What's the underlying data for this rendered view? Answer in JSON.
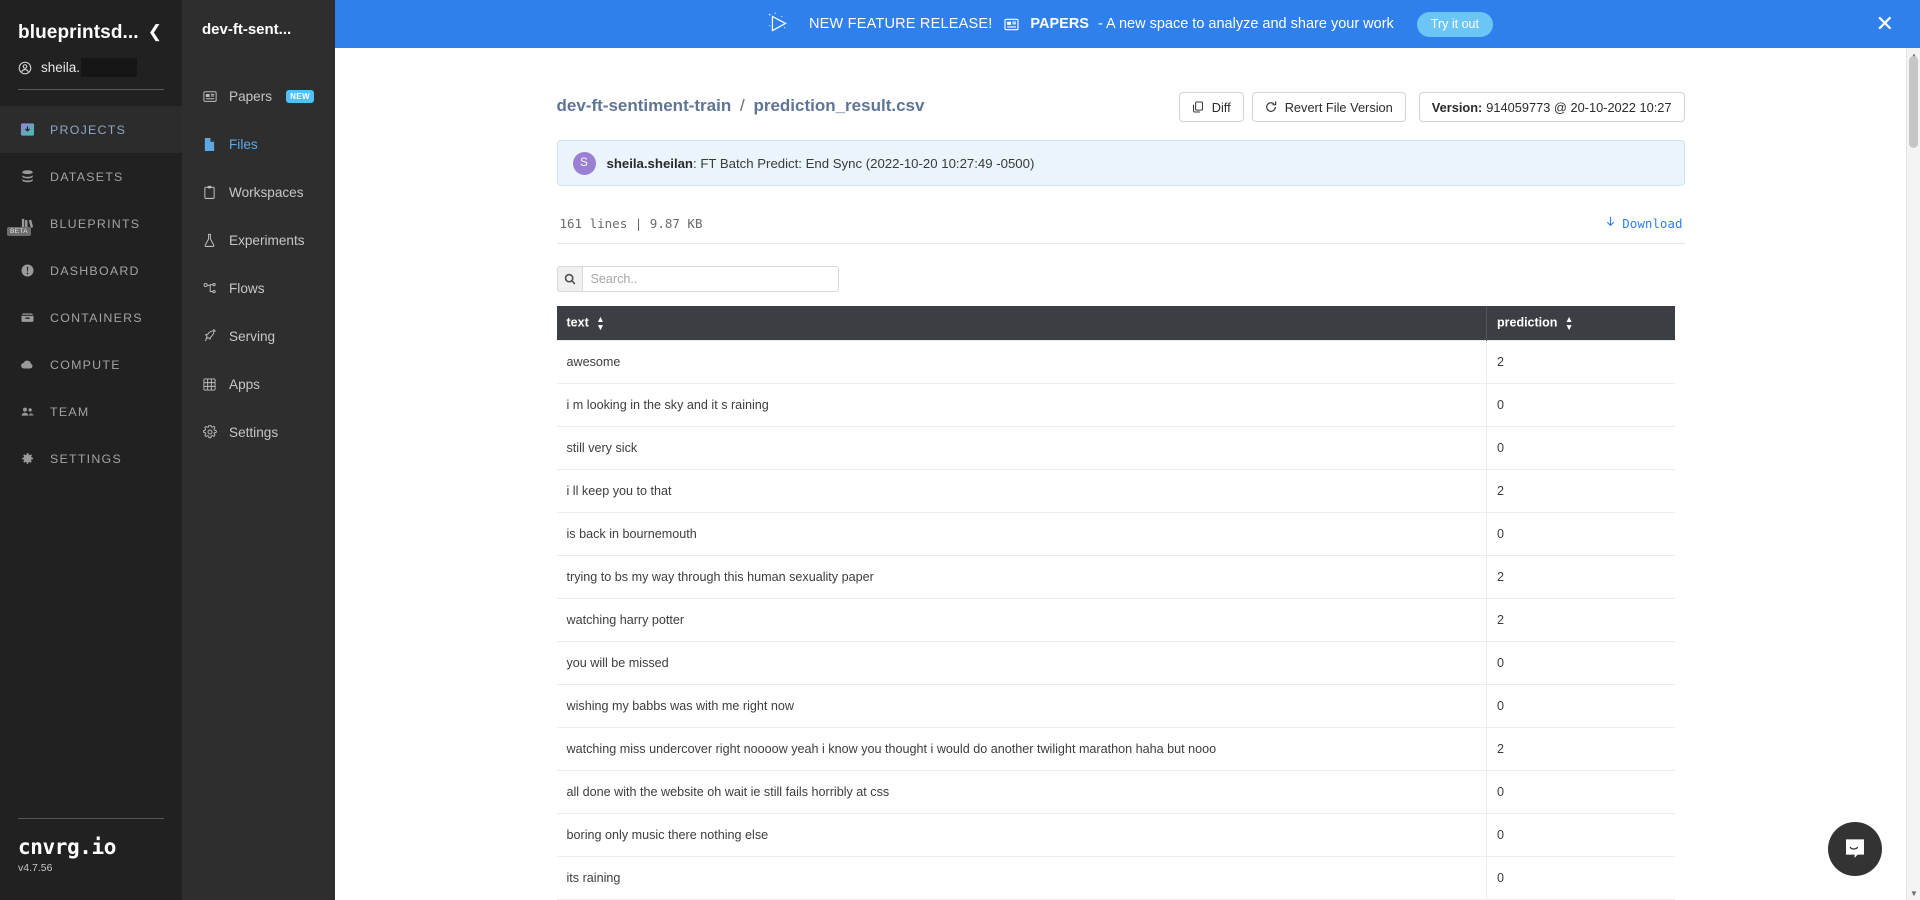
{
  "primary_sidebar": {
    "org_name": "blueprintsd...",
    "collapse_icon": "chevron-left-icon",
    "user_name": "sheila.",
    "items": [
      {
        "label": "PROJECTS",
        "icon": "projects-icon",
        "active": true
      },
      {
        "label": "DATASETS",
        "icon": "database-icon",
        "active": false
      },
      {
        "label": "BLUEPRINTS",
        "icon": "blueprints-icon",
        "active": false,
        "badge": "BETA"
      },
      {
        "label": "DASHBOARD",
        "icon": "gauge-icon",
        "active": false
      },
      {
        "label": "CONTAINERS",
        "icon": "container-icon",
        "active": false
      },
      {
        "label": "COMPUTE",
        "icon": "cloud-icon",
        "active": false
      },
      {
        "label": "TEAM",
        "icon": "team-icon",
        "active": false
      },
      {
        "label": "SETTINGS",
        "icon": "gear-icon",
        "active": false
      }
    ],
    "brand": "cnvrg.io",
    "version": "v4.7.56"
  },
  "secondary_sidebar": {
    "project_title": "dev-ft-sent...",
    "items": [
      {
        "label": "Papers",
        "icon": "papers-icon",
        "badge": "NEW",
        "active": false
      },
      {
        "label": "Files",
        "icon": "file-icon",
        "active": true
      },
      {
        "label": "Workspaces",
        "icon": "clipboard-icon",
        "active": false
      },
      {
        "label": "Experiments",
        "icon": "flask-icon",
        "active": false
      },
      {
        "label": "Flows",
        "icon": "flow-icon",
        "active": false
      },
      {
        "label": "Serving",
        "icon": "rocket-icon",
        "active": false
      },
      {
        "label": "Apps",
        "icon": "grid-icon",
        "active": false
      },
      {
        "label": "Settings",
        "icon": "gear-icon",
        "active": false
      }
    ]
  },
  "banner": {
    "kite_icon": "kite-icon",
    "lead": "NEW FEATURE RELEASE!",
    "doc_icon": "papers-icon",
    "product": "PAPERS",
    "rest": "- A new space to analyze and share your work",
    "cta_label": "Try it out",
    "close_icon": "close-icon",
    "background": "#2f80ed",
    "cta_background": "#6cc6f5"
  },
  "page": {
    "breadcrumb": {
      "project": "dev-ft-sentiment-train",
      "separator": "/",
      "file": "prediction_result.csv"
    },
    "actions": {
      "diff_label": "Diff",
      "diff_icon": "copy-icon",
      "revert_label": "Revert File Version",
      "revert_icon": "refresh-icon",
      "version_prefix": "Version:",
      "version_value": "914059773 @ 20-10-2022 10:27"
    },
    "commit": {
      "avatar_initial": "S",
      "author": "sheila.sheilan",
      "message": ": FT Batch Predict: End Sync (2022-10-20 10:27:49 -0500)"
    },
    "file_stats": "161 lines | 9.87 KB",
    "download_label": "Download",
    "download_icon": "download-arrow-icon",
    "search": {
      "placeholder": "Search..",
      "value": "",
      "icon": "search-icon"
    }
  },
  "table": {
    "columns": [
      {
        "label": "text",
        "sort_icon": "sort-both-icon"
      },
      {
        "label": "prediction",
        "sort_icon": "sort-both-icon"
      }
    ],
    "rows": [
      {
        "text": "awesome",
        "prediction": "2"
      },
      {
        "text": "i m looking in the sky and it s raining",
        "prediction": "0"
      },
      {
        "text": "still very sick",
        "prediction": "0"
      },
      {
        "text": "i ll keep you to that",
        "prediction": "2"
      },
      {
        "text": "is back in bournemouth",
        "prediction": "0"
      },
      {
        "text": "trying to bs my way through this human sexuality paper",
        "prediction": "2"
      },
      {
        "text": "watching harry potter",
        "prediction": "2"
      },
      {
        "text": "you will be missed",
        "prediction": "0"
      },
      {
        "text": "wishing my babbs was with me right now",
        "prediction": "0"
      },
      {
        "text": "watching miss undercover right noooow yeah i know you thought i would do another twilight marathon haha but nooo",
        "prediction": "2"
      },
      {
        "text": "all done with the website oh wait ie still fails horribly at css",
        "prediction": "0"
      },
      {
        "text": "boring only music there nothing else",
        "prediction": "0"
      },
      {
        "text": "its raining",
        "prediction": "0"
      }
    ]
  },
  "chat": {
    "icon": "chat-bubble-icon"
  },
  "scrollbar": {
    "up_icon": "caret-up-icon",
    "down_icon": "caret-down-icon"
  }
}
